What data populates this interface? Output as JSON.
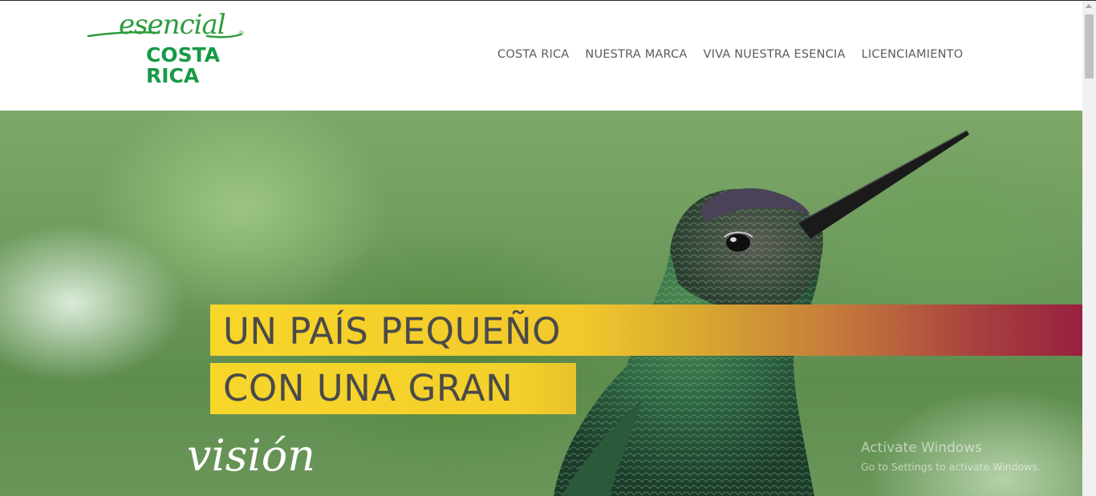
{
  "logo": {
    "script": "esencial",
    "line1": "COSTA",
    "line2": "RICA",
    "registered": "®"
  },
  "nav": {
    "items": [
      {
        "label": "COSTA RICA"
      },
      {
        "label": "NUESTRA MARCA"
      },
      {
        "label": "VIVA NUESTRA ESENCIA"
      },
      {
        "label": "LICENCIAMIENTO"
      }
    ]
  },
  "hero": {
    "line1": "UN PAÍS PEQUEÑO",
    "line2": "CON UNA GRAN",
    "script": "visión"
  },
  "watermark": {
    "title": "Activate Windows",
    "subtitle": "Go to Settings to activate Windows."
  },
  "colors": {
    "brand_green": "#179a46",
    "nav_text": "#5c5c5c",
    "band_yellow": "#f7d62a",
    "band_magenta": "#98203f"
  },
  "icons": {
    "scroll_up": "chevron-up-icon"
  }
}
